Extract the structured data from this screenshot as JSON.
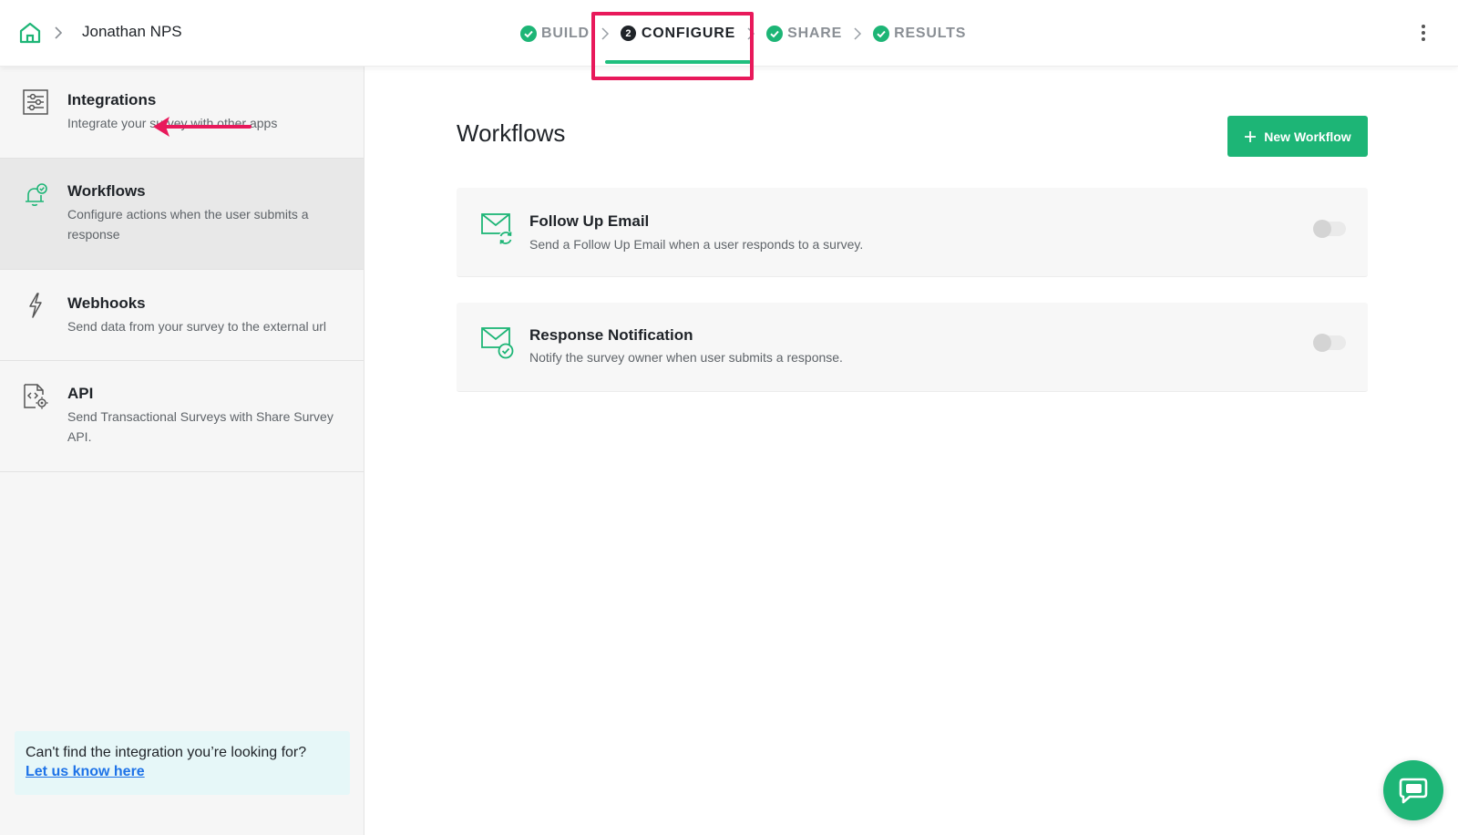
{
  "header": {
    "project_name": "Jonathan NPS",
    "steps": [
      {
        "label": "BUILD",
        "state": "done"
      },
      {
        "label": "CONFIGURE",
        "state": "active",
        "number": "2"
      },
      {
        "label": "SHARE",
        "state": "done"
      },
      {
        "label": "RESULTS",
        "state": "done"
      }
    ]
  },
  "sidebar": {
    "items": [
      {
        "title": "Integrations",
        "desc": "Integrate your survey with other apps",
        "icon": "sliders-icon"
      },
      {
        "title": "Workflows",
        "desc": "Configure actions when the user submits a response",
        "icon": "bell-check-icon"
      },
      {
        "title": "Webhooks",
        "desc": "Send data from your survey to the external url",
        "icon": "lightning-icon"
      },
      {
        "title": "API",
        "desc": "Send Transactional Surveys with Share Survey API.",
        "icon": "code-file-icon"
      }
    ],
    "help": {
      "text": "Can't find the integration you’re looking for?",
      "link": "Let us know here"
    }
  },
  "main": {
    "title": "Workflows",
    "new_button": "New Workflow",
    "workflows": [
      {
        "title": "Follow Up Email",
        "desc": "Send a Follow Up Email when a user responds to a survey.",
        "enabled": false
      },
      {
        "title": "Response Notification",
        "desc": "Notify the survey owner when user submits a response.",
        "enabled": false
      }
    ]
  },
  "colors": {
    "accent": "#1db576",
    "annotation": "#e8195b",
    "link": "#1e73e8"
  }
}
